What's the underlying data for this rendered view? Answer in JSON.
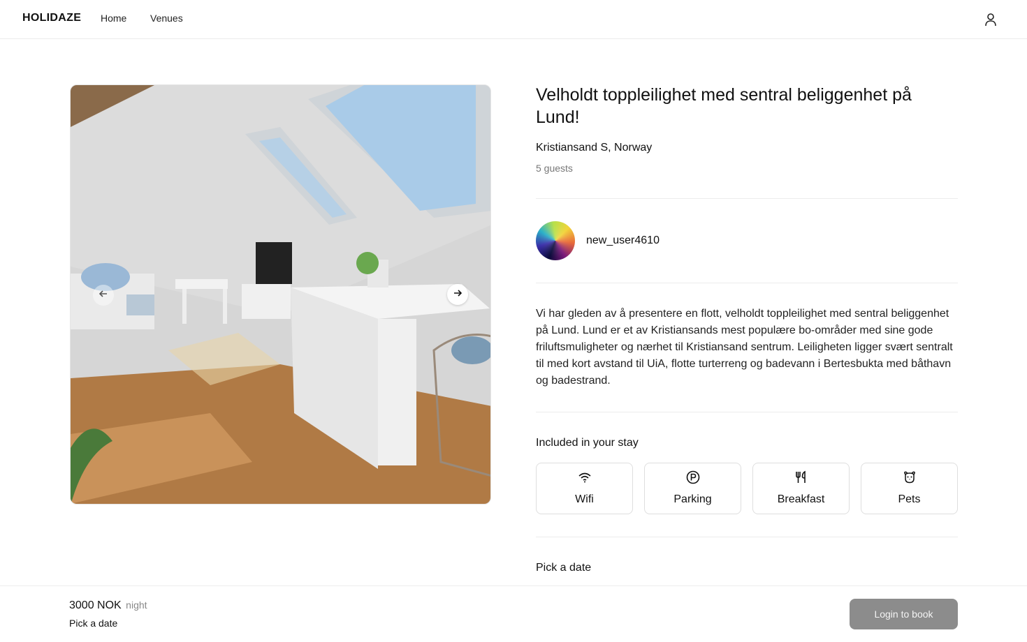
{
  "header": {
    "logo": "HOLIDAZE",
    "nav": {
      "home": "Home",
      "venues": "Venues"
    },
    "user_icon": "user-icon"
  },
  "venue": {
    "title": "Velholdt toppleilighet med sentral beliggenhet på Lund!",
    "location": "Kristiansand S, Norway",
    "guests": "5 guests",
    "host": {
      "name": "new_user4610"
    },
    "description": "Vi har gleden av å presentere en flott, velholdt toppleilighet med sentral beliggenhet på Lund. Lund er et av Kristiansands mest populære bo-områder med sine gode friluftsmuligheter og nærhet til Kristiansand sentrum. Leiligheten ligger svært sentralt til med kort avstand til UiA, flotte turterreng og badevann i Bertesbukta med båthavn og badestrand."
  },
  "carousel": {
    "prev_icon": "arrow-left-icon",
    "next_icon": "arrow-right-icon"
  },
  "included": {
    "title": "Included in your stay",
    "items": [
      {
        "label": "Wifi",
        "icon": "wifi-icon"
      },
      {
        "label": "Parking",
        "icon": "parking-icon"
      },
      {
        "label": "Breakfast",
        "icon": "utensils-icon"
      },
      {
        "label": "Pets",
        "icon": "pet-icon"
      }
    ]
  },
  "pick_date": {
    "title": "Pick a date"
  },
  "booking": {
    "price": "3000 NOK",
    "per": "night",
    "date_hint": "Pick a date",
    "button": "Login to book"
  },
  "colors": {
    "button_bg": "#8c8c8c",
    "divider": "#ececec"
  }
}
